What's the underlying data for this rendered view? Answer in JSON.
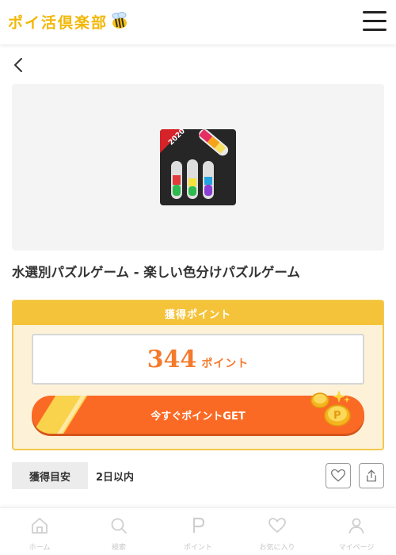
{
  "header": {
    "logo_text": "ポイ活倶楽部",
    "menu_icon": "hamburger-icon",
    "brand_color": "#f2b705"
  },
  "nav": {
    "back_icon": "chevron-left-icon"
  },
  "app": {
    "icon_badge": "2020",
    "title": "水選別パズルゲーム - 楽しい色分けパズルゲーム"
  },
  "points": {
    "header_label": "獲得ポイント",
    "value": "344",
    "unit": "ポイント",
    "get_button_label": "今すぐポイントGET",
    "accent_color": "#fb6a24"
  },
  "guide": {
    "label": "獲得目安",
    "value": "2日以内"
  },
  "actions": {
    "favorite_icon": "heart-icon",
    "share_icon": "share-icon"
  },
  "bottom_nav": {
    "items": [
      {
        "label": "ホーム",
        "icon": "home-icon"
      },
      {
        "label": "検索",
        "icon": "search-icon"
      },
      {
        "label": "ポイント",
        "icon": "point-p-icon"
      },
      {
        "label": "お気に入り",
        "icon": "heart-icon"
      },
      {
        "label": "マイページ",
        "icon": "user-icon"
      }
    ]
  }
}
